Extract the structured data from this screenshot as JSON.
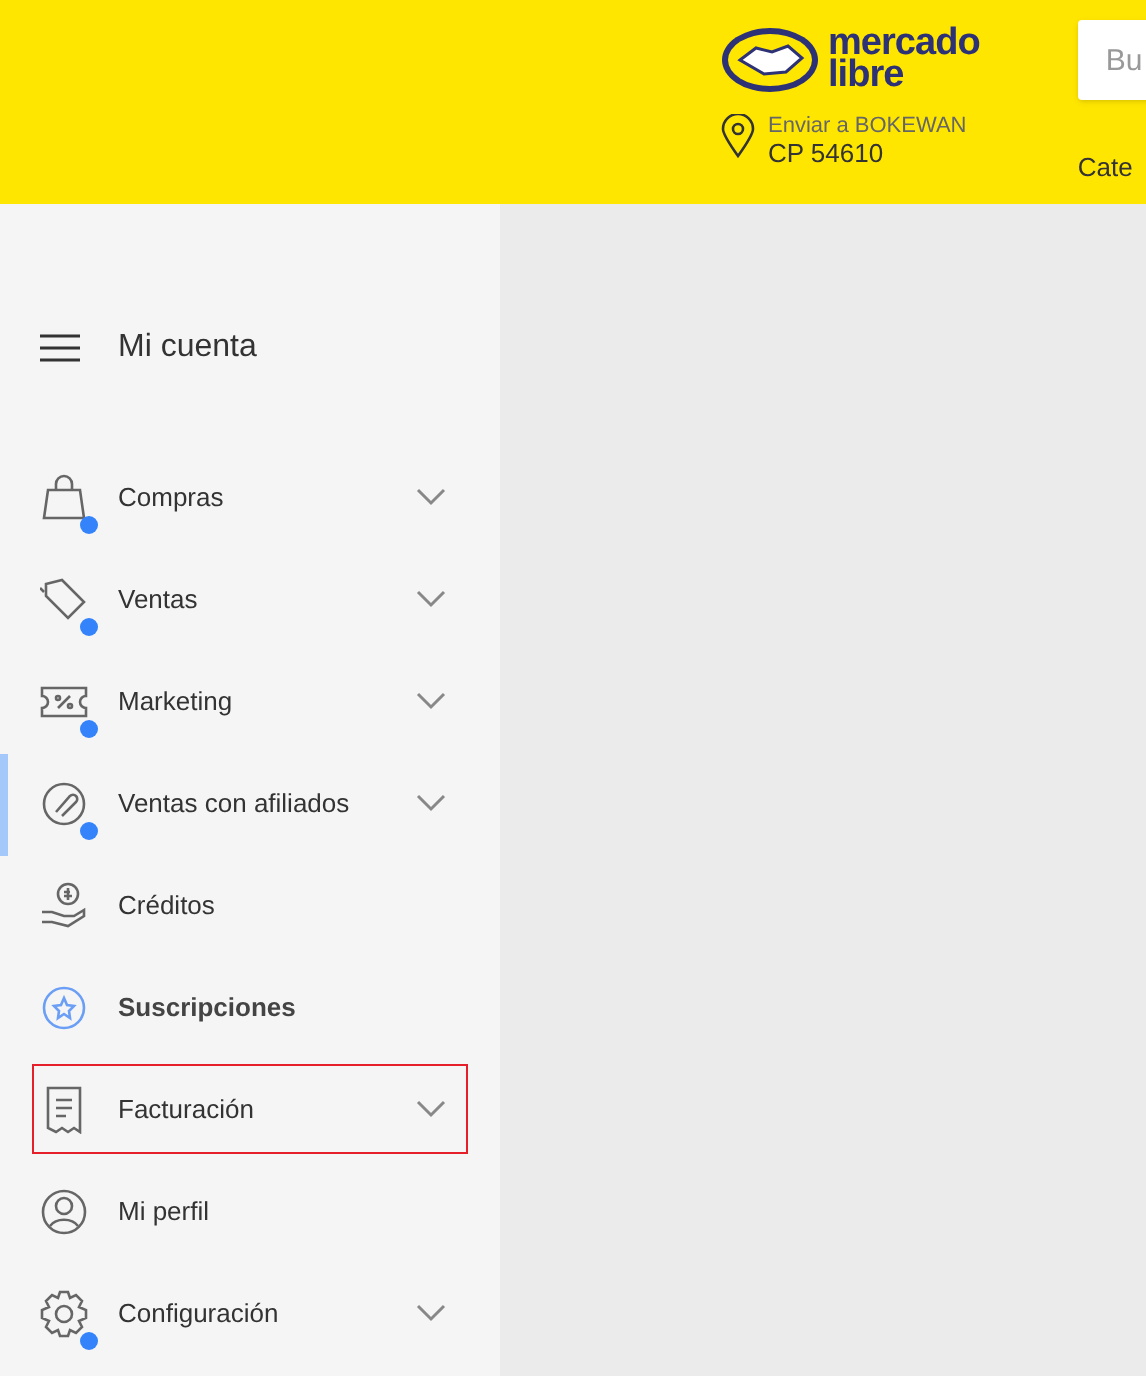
{
  "header": {
    "logo": [
      "mercado",
      "libre"
    ],
    "search": {
      "placeholder": "Bu"
    },
    "location": {
      "label": "Enviar a BOKEWAN",
      "postal_code": "CP 54610"
    },
    "nav_link": "Cate"
  },
  "sidebar": {
    "title": "Mi cuenta",
    "items": [
      {
        "label": "Compras",
        "notification": true,
        "expandable": true,
        "selected": false,
        "emphasized": false,
        "outlined": false
      },
      {
        "label": "Ventas",
        "notification": true,
        "expandable": true,
        "selected": false,
        "emphasized": false,
        "outlined": false
      },
      {
        "label": "Marketing",
        "notification": true,
        "expandable": true,
        "selected": false,
        "emphasized": false,
        "outlined": false
      },
      {
        "label": "Ventas con afiliados",
        "notification": true,
        "expandable": true,
        "selected": true,
        "emphasized": false,
        "outlined": false
      },
      {
        "label": "Créditos",
        "notification": false,
        "expandable": false,
        "selected": false,
        "emphasized": false,
        "outlined": false
      },
      {
        "label": "Suscripciones",
        "notification": false,
        "expandable": false,
        "selected": false,
        "emphasized": true,
        "outlined": false
      },
      {
        "label": "Facturación",
        "notification": false,
        "expandable": true,
        "selected": false,
        "emphasized": false,
        "outlined": true
      },
      {
        "label": "Mi perfil",
        "notification": false,
        "expandable": false,
        "selected": false,
        "emphasized": false,
        "outlined": false
      },
      {
        "label": "Configuración",
        "notification": true,
        "expandable": true,
        "selected": false,
        "emphasized": false,
        "outlined": false
      }
    ]
  }
}
